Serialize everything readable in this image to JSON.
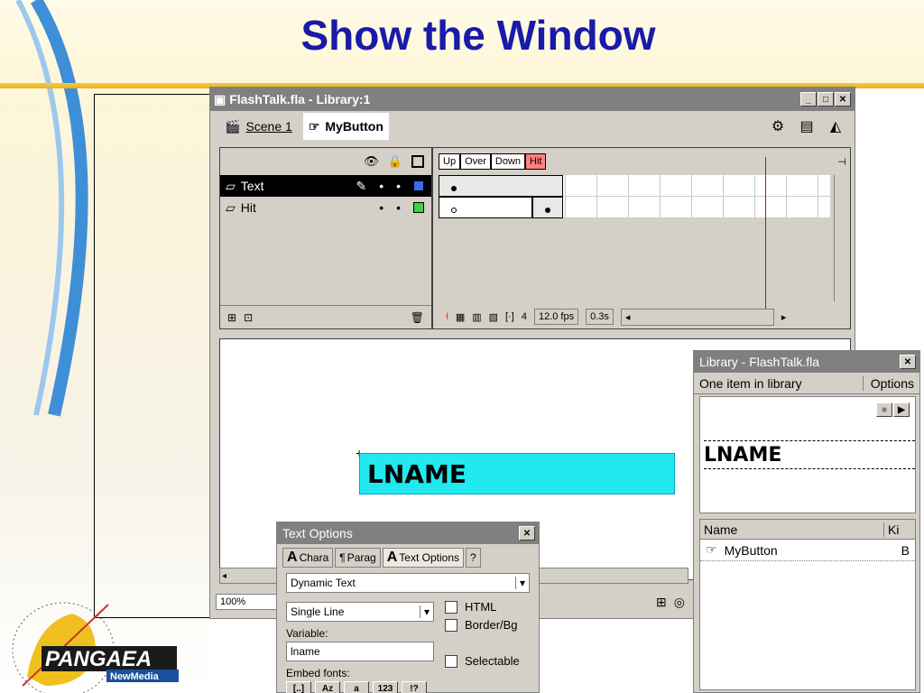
{
  "slide": {
    "title": "Show the Window",
    "logo_text": "PANGAEA",
    "logo_sub": "NewMedia"
  },
  "window": {
    "title": "FlashTalk.fla - Library:1",
    "scene": "Scene 1",
    "symbol": "MyButton"
  },
  "timeline": {
    "frame_labels": [
      "Up",
      "Over",
      "Down",
      "Hit"
    ],
    "layers": [
      {
        "name": "Text",
        "color": "#3a6cf0",
        "selected": true
      },
      {
        "name": "Hit",
        "color": "#40d040",
        "selected": false
      }
    ],
    "current_frame": "4",
    "fps": "12.0 fps",
    "time": "0.3s"
  },
  "stage": {
    "field_text": "LNAME",
    "zoom": "100%"
  },
  "library": {
    "title": "Library - FlashTalk.fla",
    "count": "One item in library",
    "options": "Options",
    "preview_text": "LNAME",
    "col_name": "Name",
    "col_kind": "Ki",
    "items": [
      {
        "name": "MyButton",
        "kind": "B"
      }
    ]
  },
  "text_options": {
    "title": "Text Options",
    "tabs": [
      "Chara",
      "Parag",
      "Text Options"
    ],
    "text_type": "Dynamic Text",
    "line_type": "Single Line",
    "variable_label": "Variable:",
    "variable_value": "lname",
    "embed_label": "Embed fonts:",
    "checkboxes": [
      "HTML",
      "Border/Bg",
      "Selectable"
    ]
  }
}
